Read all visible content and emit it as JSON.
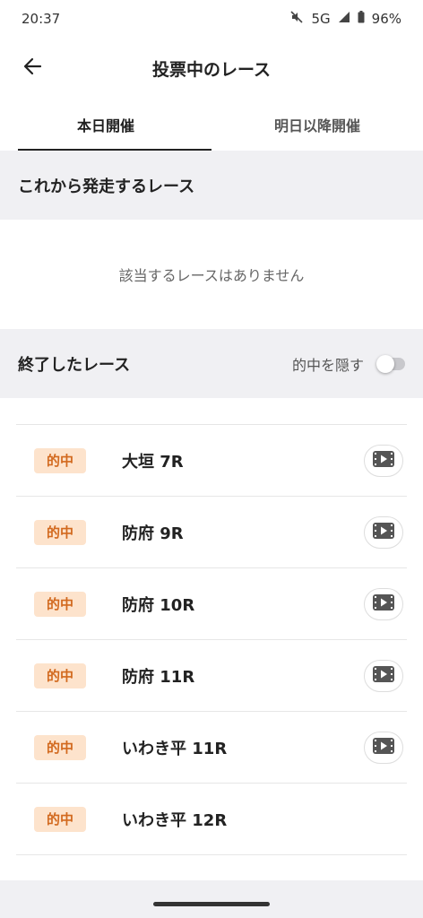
{
  "status": {
    "time": "20:37",
    "network": "5G",
    "battery": "96%"
  },
  "header": {
    "title": "投票中のレース"
  },
  "tabs": [
    {
      "label": "本日開催",
      "active": true
    },
    {
      "label": "明日以降開催",
      "active": false
    }
  ],
  "upcoming": {
    "title": "これから発走するレース",
    "empty_message": "該当するレースはありません"
  },
  "finished": {
    "title": "終了したレース",
    "hide_hits_label": "的中を隠す",
    "hide_hits_on": false,
    "races": [
      {
        "badge": "的中",
        "name": "大垣 7R",
        "video": true
      },
      {
        "badge": "的中",
        "name": "防府 9R",
        "video": true
      },
      {
        "badge": "的中",
        "name": "防府 10R",
        "video": true
      },
      {
        "badge": "的中",
        "name": "防府 11R",
        "video": true
      },
      {
        "badge": "的中",
        "name": "いわき平 11R",
        "video": true
      },
      {
        "badge": "的中",
        "name": "いわき平 12R",
        "video": false
      }
    ]
  },
  "colors": {
    "accent_badge_bg": "#fde3cc",
    "accent_badge_text": "#d2691e",
    "section_bg": "#f0f0f3"
  }
}
